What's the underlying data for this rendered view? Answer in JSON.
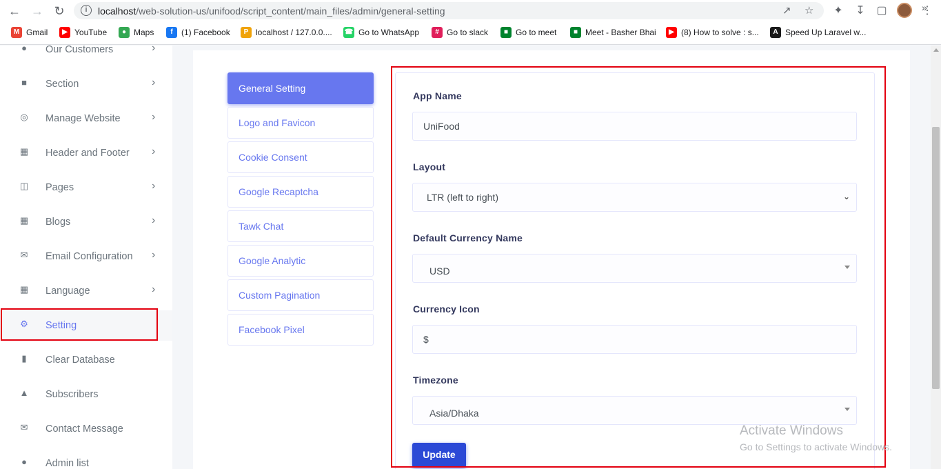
{
  "browser": {
    "url_host": "localhost",
    "url_path": "/web-solution-us/unifood/script_content/main_files/admin/general-setting",
    "bookmarks": [
      {
        "label": "Gmail",
        "icon": "gmail-icon",
        "color": "#ea4335"
      },
      {
        "label": "YouTube",
        "icon": "youtube-icon",
        "color": "#ff0000"
      },
      {
        "label": "Maps",
        "icon": "maps-icon",
        "color": "#34a853"
      },
      {
        "label": "(1) Facebook",
        "icon": "facebook-icon",
        "color": "#1877f2"
      },
      {
        "label": "localhost / 127.0.0....",
        "icon": "phpmyadmin-icon",
        "color": "#f0a30a"
      },
      {
        "label": "Go to WhatsApp",
        "icon": "whatsapp-icon",
        "color": "#25d366"
      },
      {
        "label": "Go to slack",
        "icon": "slack-icon",
        "color": "#e01e5a"
      },
      {
        "label": "Go to meet",
        "icon": "meet-icon",
        "color": "#00832d"
      },
      {
        "label": "Meet - Basher Bhai",
        "icon": "meet-icon",
        "color": "#00832d"
      },
      {
        "label": "(8) How to solve : s...",
        "icon": "youtube-icon",
        "color": "#ff0000"
      },
      {
        "label": "Speed Up Laravel w...",
        "icon": "laravel-icon",
        "color": "#1a1a1a"
      }
    ]
  },
  "sidebar": {
    "items": [
      {
        "label": "Our Customers",
        "icon": "users-icon",
        "chevron": true
      },
      {
        "label": "Section",
        "icon": "cart-icon",
        "chevron": true
      },
      {
        "label": "Manage Website",
        "icon": "globe-icon",
        "chevron": true
      },
      {
        "label": "Header and Footer",
        "icon": "grid-icon",
        "chevron": true
      },
      {
        "label": "Pages",
        "icon": "columns-icon",
        "chevron": true
      },
      {
        "label": "Blogs",
        "icon": "grid-icon",
        "chevron": true
      },
      {
        "label": "Email Configuration",
        "icon": "envelope-icon",
        "chevron": true
      },
      {
        "label": "Language",
        "icon": "grid-icon",
        "chevron": true
      },
      {
        "label": "Setting",
        "icon": "gear-icon",
        "chevron": false,
        "active": true
      },
      {
        "label": "Clear Database",
        "icon": "trash-icon",
        "chevron": false
      },
      {
        "label": "Subscribers",
        "icon": "fire-icon",
        "chevron": false
      },
      {
        "label": "Contact Message",
        "icon": "envelope-icon",
        "chevron": false
      },
      {
        "label": "Admin list",
        "icon": "user-icon",
        "chevron": false
      }
    ]
  },
  "tabs": [
    {
      "label": "General Setting",
      "active": true
    },
    {
      "label": "Logo and Favicon"
    },
    {
      "label": "Cookie Consent"
    },
    {
      "label": "Google Recaptcha"
    },
    {
      "label": "Tawk Chat"
    },
    {
      "label": "Google Analytic"
    },
    {
      "label": "Custom Pagination"
    },
    {
      "label": "Facebook Pixel"
    }
  ],
  "form": {
    "app_name_label": "App Name",
    "app_name_value": "UniFood",
    "layout_label": "Layout",
    "layout_value": "LTR (left to right)",
    "currency_name_label": "Default Currency Name",
    "currency_name_value": "USD",
    "currency_icon_label": "Currency Icon",
    "currency_icon_value": "$",
    "timezone_label": "Timezone",
    "timezone_value": "Asia/Dhaka",
    "update_label": "Update"
  },
  "watermark": {
    "line1": "Activate Windows",
    "line2": "Go to Settings to activate Windows."
  },
  "colors": {
    "accent": "#6777ef",
    "update_button": "#2b49d6",
    "highlight": "#e3000f"
  }
}
